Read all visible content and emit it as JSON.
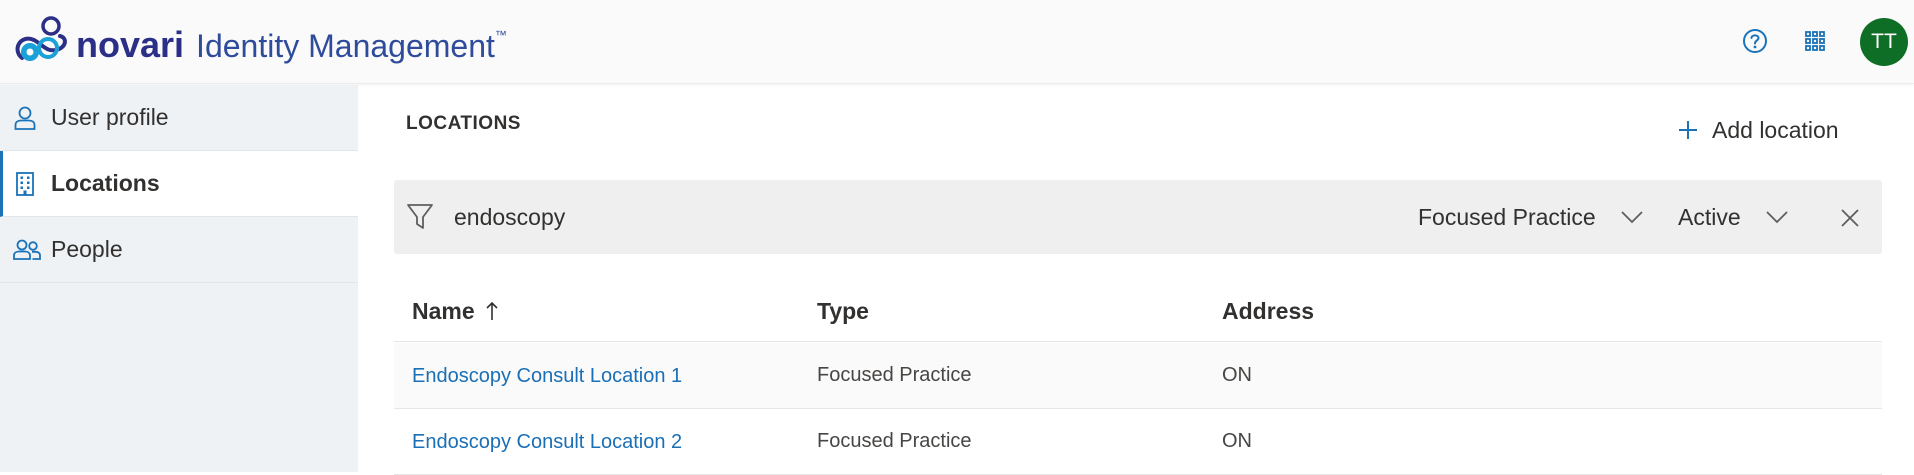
{
  "header": {
    "brand_name": "novari",
    "product_name": "Identity Management",
    "trademark": "™",
    "help_icon": "question-circle-icon",
    "apps_icon": "app-launcher-grid-icon",
    "avatar_initials": "TT",
    "avatar_color": "#0f6e26",
    "brand_color": "#2b2f86"
  },
  "sidebar": {
    "items": [
      {
        "label": "User profile",
        "icon": "person-icon",
        "active": false
      },
      {
        "label": "Locations",
        "icon": "building-icon",
        "active": true
      },
      {
        "label": "People",
        "icon": "people-icon",
        "active": false
      }
    ]
  },
  "main": {
    "title": "LOCATIONS",
    "add_label": "Add location",
    "filter": {
      "icon": "filter-icon",
      "search_value": "endoscopy",
      "type_value": "Focused Practice",
      "status_value": "Active",
      "clear_icon": "close-icon"
    },
    "table": {
      "columns": [
        "Name",
        "Type",
        "Address"
      ],
      "sort_indicator": "ascending",
      "rows": [
        {
          "name": "Endoscopy Consult Location 1",
          "type": "Focused Practice",
          "address": "ON"
        },
        {
          "name": "Endoscopy Consult Location 2",
          "type": "Focused Practice",
          "address": "ON"
        }
      ]
    }
  },
  "colors": {
    "accent": "#1a73b8",
    "link": "#1a6fb5",
    "sidebar_bg": "#eef2f5",
    "filter_bg": "#efefef"
  }
}
